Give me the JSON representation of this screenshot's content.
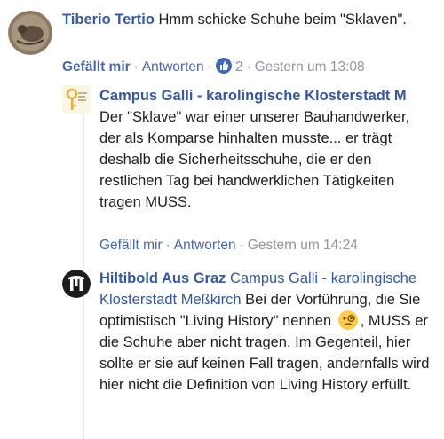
{
  "comments": [
    {
      "author": "Tiberio Tertio",
      "text": " Hmm schicke Schuhe beim \"Sklaven\".",
      "like_label": "Gefällt mir",
      "reply_label": "Antworten",
      "like_count": "2",
      "timestamp": "Gestern um 13:08"
    },
    {
      "author": "Campus Galli - karolingische Klosterstadt M",
      "text": "Der \"Sklave\" war einer unserer Bauhandwerker, der als Komparse hinhalten musste... er trägt deshalb die Sicherheitsschuhe, die er den restlichen Tag bei handwerklichen Tätigkeiten tragen MUSS.",
      "like_label": "Gefällt mir",
      "reply_label": "Antworten",
      "timestamp": "Gestern um 14:24"
    },
    {
      "author": "Hiltibold Aus Graz",
      "mention": "Campus Galli - karolingische Klosterstadt Meßkirch",
      "text_before_emoji": " Bei der Vorführung, die Sie optimistisch \"Living History\" nennen",
      "text_after_emoji": ", MUSS er die Schuhe aber nicht tragen. Im Gegenteil, hier sollte er sie auf keinen Fall tragen, andernfalls wird hier nicht die Definition von Living History erfüllt."
    }
  ],
  "colors": {
    "link": "#385898",
    "meta": "#90949c",
    "like_badge": "#4267b2"
  },
  "icons": [
    "coin-avatar-icon",
    "campus-galli-logo-icon",
    "hiltibold-avatar-icon",
    "thumbs-up-icon",
    "face-with-monocle-emoji"
  ]
}
